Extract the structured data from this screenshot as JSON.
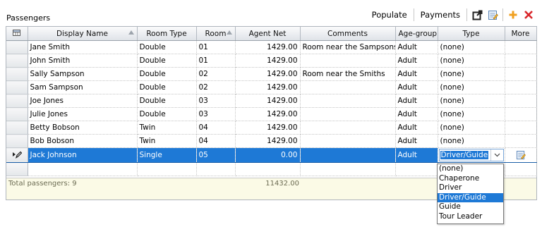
{
  "panel": {
    "title": "Passengers"
  },
  "toolbar": {
    "populate_label": "Populate",
    "payments_label": "Payments"
  },
  "columns": [
    "Display Name",
    "Room Type",
    "Room",
    "Agent Net",
    "Comments",
    "Age-group",
    "Type",
    "More"
  ],
  "rows": [
    {
      "name": "Jane Smith",
      "room_type": "Double",
      "room": "01",
      "agent_net": "1429.00",
      "comments": "Room near the Sampsons",
      "age_group": "Adult",
      "type": "(none)"
    },
    {
      "name": "John Smith",
      "room_type": "Double",
      "room": "01",
      "agent_net": "1429.00",
      "comments": "",
      "age_group": "Adult",
      "type": "(none)"
    },
    {
      "name": "Sally Sampson",
      "room_type": "Double",
      "room": "02",
      "agent_net": "1429.00",
      "comments": "Room near the Smiths",
      "age_group": "Adult",
      "type": "(none)"
    },
    {
      "name": "Sam Sampson",
      "room_type": "Double",
      "room": "02",
      "agent_net": "1429.00",
      "comments": "",
      "age_group": "Adult",
      "type": "(none)"
    },
    {
      "name": "Joe Jones",
      "room_type": "Double",
      "room": "03",
      "agent_net": "1429.00",
      "comments": "",
      "age_group": "Adult",
      "type": "(none)"
    },
    {
      "name": "Julie Jones",
      "room_type": "Double",
      "room": "03",
      "agent_net": "1429.00",
      "comments": "",
      "age_group": "Adult",
      "type": "(none)"
    },
    {
      "name": "Betty Bobson",
      "room_type": "Twin",
      "room": "04",
      "agent_net": "1429.00",
      "comments": "",
      "age_group": "Adult",
      "type": "(none)"
    },
    {
      "name": "Bob Bobson",
      "room_type": "Twin",
      "room": "04",
      "agent_net": "1429.00",
      "comments": "",
      "age_group": "Adult",
      "type": "(none)"
    }
  ],
  "selected_row": {
    "name": "Jack Johnson",
    "room_type": "Single",
    "room": "05",
    "agent_net": "0.00",
    "comments": "",
    "age_group": "Adult",
    "type": "Driver/Guide"
  },
  "footer": {
    "total_label": "Total passengers: 9",
    "total_net": "11432.00"
  },
  "type_options": [
    "(none)",
    "Chaperone",
    "Driver",
    "Driver/Guide",
    "Guide",
    "Tour Leader"
  ],
  "type_highlighted": "Driver/Guide",
  "colors": {
    "selection": "#1e79d6",
    "footer_bg": "#fbfae6",
    "delete_red": "#d9262a",
    "add_orange": "#f0a020"
  }
}
